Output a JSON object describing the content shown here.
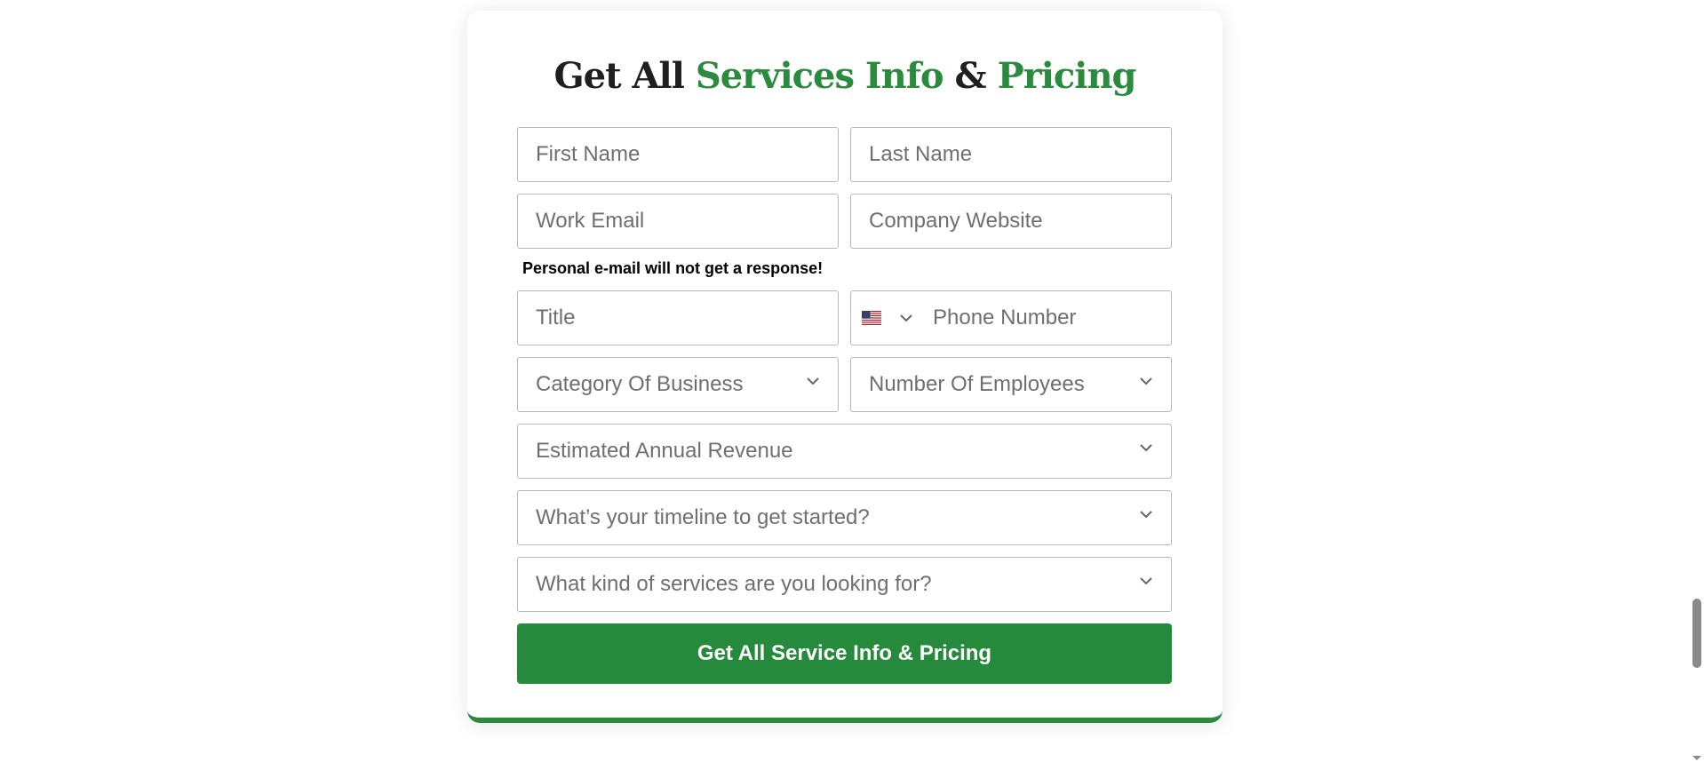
{
  "heading": {
    "part1": "Get All ",
    "part2": "Services Info",
    "part3": " & ",
    "part4": "Pricing"
  },
  "fields": {
    "first_name": "First Name",
    "last_name": "Last Name",
    "work_email": "Work Email",
    "company_website": "Company Website",
    "title": "Title",
    "phone_number": "Phone Number"
  },
  "note": "Personal e-mail will not get a response!",
  "selects": {
    "category": "Category Of Business",
    "employees": "Number Of Employees",
    "revenue": "Estimated Annual Revenue",
    "timeline": "What’s your timeline to get started?",
    "services": "What kind of services are you looking for?"
  },
  "submit_label": "Get All Service Info & Pricing",
  "colors": {
    "accent": "#2a8a3e",
    "button": "#268a3c",
    "heading": "#1f1f1f",
    "placeholder": "#6f6f6f",
    "border": "#b8b8b8"
  },
  "icons": {
    "flag": "us-flag-icon",
    "dropdown": "chevron-down-icon"
  }
}
